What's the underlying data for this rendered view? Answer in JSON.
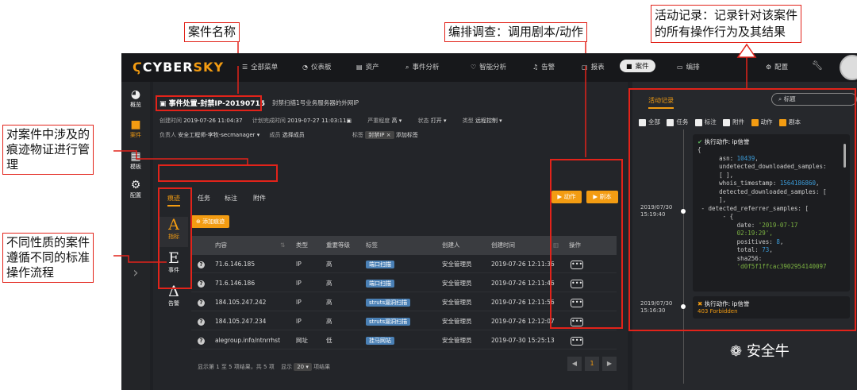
{
  "annotations": {
    "case_name": "案件名称",
    "orchestration": "编排调查：调用剧本/动作",
    "activity_line1": "活动记录：记录针对该案件",
    "activity_line2": "的所有操作行为及其结果",
    "evidence_line1": "对案件中涉及的",
    "evidence_line2": "痕迹物证进行管",
    "evidence_line3": "理",
    "flow_line1": "不同性质的案件",
    "flow_line2": "遵循不同的标准",
    "flow_line3": "操作流程"
  },
  "topbar": {
    "logo_a": "CYBER",
    "logo_b": "SKY",
    "nav": [
      "全部菜单",
      "仪表板",
      "资产",
      "事件分析",
      "智能分析",
      "告警",
      "报表",
      "案件",
      "编排",
      "配置"
    ]
  },
  "leftnav": [
    "概览",
    "案件",
    "模板",
    "配置"
  ],
  "case": {
    "title": "事件处置-封禁IP-20190715",
    "desc": "封禁扫描1号业务服务器的外网IP",
    "created_label": "创建时间",
    "created": "2019-07-26 11:04:37",
    "plan_label": "计划完成时间",
    "plan": "2019-07-27 11:03:11",
    "severity_label": "严重程度",
    "severity": "高 ▾",
    "status_label": "状态",
    "status": "打开 ▾",
    "type_label": "类型",
    "type": "远程控制 ▾",
    "owner_label": "负责人",
    "owner": "安全工程师-李牧-secmanager ▾",
    "member_label": "成员",
    "member": "选择成员",
    "tag_label": "标签",
    "tag": "封禁IP ×",
    "add_tag": "添加标签"
  },
  "tabs": [
    "痕迹",
    "任务",
    "标注",
    "附件"
  ],
  "actions": {
    "action": "▶ 动作",
    "playbook": "▶ 剧本"
  },
  "types": [
    {
      "glyph": "A",
      "label": "指标"
    },
    {
      "glyph": "E",
      "label": "事件"
    },
    {
      "glyph": "Δ",
      "label": "告警"
    }
  ],
  "add_trace": "⊕ 添加痕迹",
  "table": {
    "headers": [
      "内容",
      "类型",
      "重要等级",
      "标签",
      "创建人",
      "创建时间",
      "操作"
    ],
    "rows": [
      {
        "content": "71.6.146.185",
        "type": "IP",
        "level": "高",
        "tag": "端口扫描",
        "creator": "安全管理员",
        "time": "2019-07-26 12:11:36"
      },
      {
        "content": "71.6.146.186",
        "type": "IP",
        "level": "高",
        "tag": "端口扫描",
        "creator": "安全管理员",
        "time": "2019-07-26 12:11:46"
      },
      {
        "content": "184.105.247.242",
        "type": "IP",
        "level": "高",
        "tag": "struts漏洞扫描",
        "creator": "安全管理员",
        "time": "2019-07-26 12:11:56"
      },
      {
        "content": "184.105.247.234",
        "type": "IP",
        "level": "高",
        "tag": "struts漏洞扫描",
        "creator": "安全管理员",
        "time": "2019-07-26 12:12:07"
      },
      {
        "content": "alegroup.info/ntnrrhst",
        "type": "网址",
        "level": "低",
        "tag": "挂马网站",
        "creator": "安全管理员",
        "time": "2019-07-30 15:25:13"
      }
    ]
  },
  "footer": {
    "summary": "显示第 1 至 5 项结果，共 5 项",
    "show": "显示",
    "size": "20 ▾",
    "unit": "项结果",
    "prev": "◀",
    "page": "1",
    "next": "▶"
  },
  "activity": {
    "tab": "活动记录",
    "search_placeholder": "标题",
    "filters": [
      {
        "label": "全部",
        "checked": false
      },
      {
        "label": "任务",
        "checked": false
      },
      {
        "label": "标注",
        "checked": false
      },
      {
        "label": "附件",
        "checked": false
      },
      {
        "label": "动作",
        "checked": true
      },
      {
        "label": "剧本",
        "checked": true
      }
    ],
    "entries": [
      {
        "date": "2019/07/30",
        "time": "15:19:40",
        "status": "✔",
        "title": "执行动作: ip信誉"
      },
      {
        "date": "2019/07/30",
        "time": "15:16:30",
        "status": "✖",
        "title": "执行动作: ip信誉",
        "result": "403 Forbidden"
      }
    ],
    "code": {
      "open": "{",
      "asn_key": "asn: ",
      "asn_val": "10439",
      "undet_key": "undetected_downloaded_samples:",
      "undet_val": "[ ],",
      "whois_key": "whois_timestamp: ",
      "whois_val": "1564186860",
      "det_key": "detected_downloaded_samples: [",
      "det_close": "],",
      "ref_key": "- detected_referrer_samples: [",
      "brace": "- {",
      "date_key": "date: ",
      "date_val": "'2019-07-17",
      "date_val2": "02:19:29'",
      "pos_key": "positives: ",
      "pos_val": "8",
      "total_key": "total: ",
      "total_val": "73",
      "sha_key": "sha256:",
      "sha_val": "'d0f5f1ffcac3902954140097"
    }
  },
  "watermark": "安全牛"
}
